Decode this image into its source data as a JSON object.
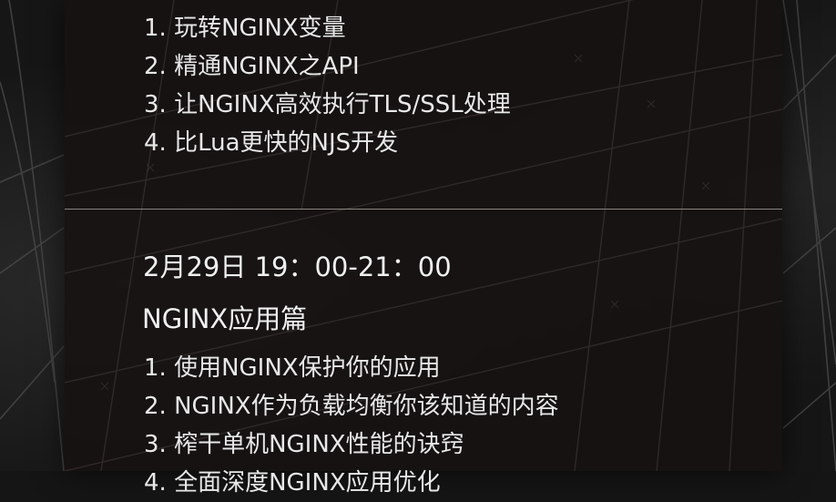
{
  "section_one": {
    "items": [
      "1. 玩转NGINX变量",
      "2. 精通NGINX之API",
      "3. 让NGINX高效执行TLS/SSL处理",
      "4. 比Lua更快的NJS开发"
    ]
  },
  "section_two": {
    "date": "2月29日  19：00-21：00",
    "title": "NGINX应用篇",
    "items": [
      "1. 使用NGINX保护你的应用",
      "2. NGINX作为负载均衡你该知道的内容",
      "3. 榨干单机NGINX性能的诀窍",
      "4. 全面深度NGINX应用优化"
    ]
  },
  "colors": {
    "background": "#151515",
    "panel": "#1a1514",
    "text": "#e8e8e8",
    "divider": "#8a8580"
  }
}
